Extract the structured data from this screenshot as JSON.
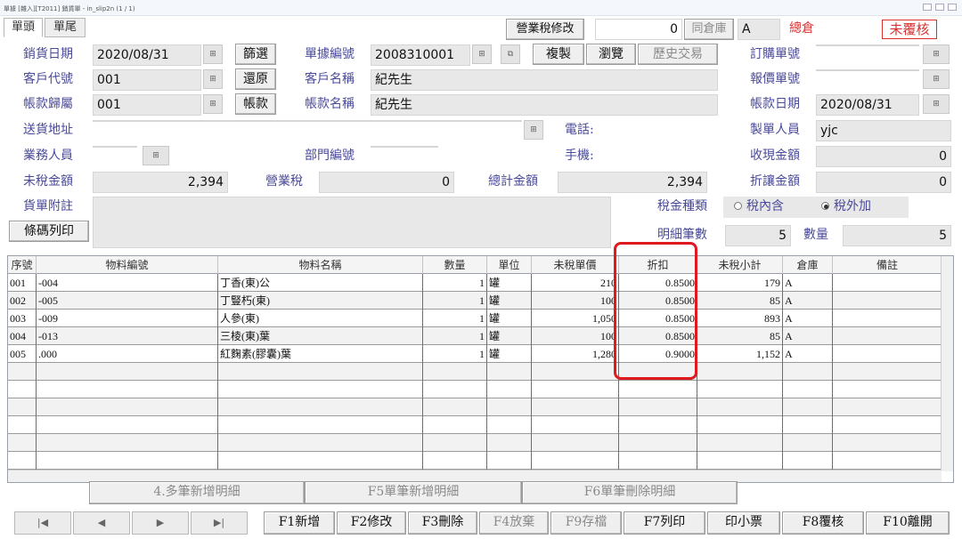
{
  "window": {
    "title": "單據 [雜入][T2011] 銷貨單 - in_slip2n  (1 / 1)"
  },
  "tabs": [
    "單頭",
    "單尾"
  ],
  "top": {
    "tax_modify_btn": "營業稅修改",
    "tax_value": "0",
    "same_warehouse_label": "同倉庫",
    "warehouse_code": "A",
    "warehouse_name": "總倉",
    "review_status": "未覆核"
  },
  "header": {
    "sale_date_label": "銷貨日期",
    "sale_date": "2020/08/31",
    "filter_btn": "篩選",
    "doc_no_label": "單據編號",
    "doc_no": "2008310001",
    "copy_btn": "複製",
    "browse_btn": "瀏覽",
    "history_btn": "歷史交易",
    "order_no_label": "訂購單號",
    "order_no": "",
    "customer_code_label": "客戶代號",
    "customer_code": "001",
    "restore_btn": "還原",
    "customer_name_label": "客戶名稱",
    "customer_name": "紀先生",
    "quote_no_label": "報價單號",
    "quote_no": "",
    "account_owner_label": "帳款歸屬",
    "account_owner": "001",
    "account_btn": "帳款",
    "account_name_label": "帳款名稱",
    "account_name": "紀先生",
    "account_date_label": "帳款日期",
    "account_date": "2020/08/31",
    "ship_addr_label": "送貨地址",
    "ship_addr": "",
    "phone_label": "電話:",
    "phone": "",
    "maker_label": "製單人員",
    "maker": "yjc",
    "salesperson_label": "業務人員",
    "salesperson": "",
    "dept_label": "部門編號",
    "dept": "",
    "mobile_label": "手機:",
    "mobile": "",
    "cash_label": "收現金額",
    "cash": "0",
    "untaxed_label": "未稅金額",
    "untaxed": "2,394",
    "tax_label": "營業稅",
    "tax": "0",
    "total_label": "總計金額",
    "total": "2,394",
    "discount_amt_label": "折讓金額",
    "discount_amt": "0",
    "note_label": "貨單附註",
    "note": "",
    "tax_type_label": "稅金種類",
    "tax_incl": "稅內含",
    "tax_excl": "稅外加",
    "tax_type_selected": "稅外加",
    "barcode_btn": "條碼列印",
    "detail_count_label": "明細筆數",
    "detail_count": "5",
    "qty_label": "數量",
    "qty_total": "5"
  },
  "grid": {
    "columns": [
      "序號",
      "物料編號",
      "物料名稱",
      "數量",
      "單位",
      "未稅單價",
      "折扣",
      "未稅小計",
      "倉庫",
      "備註"
    ],
    "rows": [
      {
        "seq": "001",
        "code": "-004",
        "name": "丁香(東)公",
        "qty": "1",
        "unit": "罐",
        "price": "210",
        "discount": "0.8500",
        "subtotal": "179",
        "wh": "A",
        "remark": ""
      },
      {
        "seq": "002",
        "code": "-005",
        "name": "丁豎朽(東)",
        "qty": "1",
        "unit": "罐",
        "price": "100",
        "discount": "0.8500",
        "subtotal": "85",
        "wh": "A",
        "remark": ""
      },
      {
        "seq": "003",
        "code": "-009",
        "name": "人參(東)",
        "qty": "1",
        "unit": "罐",
        "price": "1,050",
        "discount": "0.8500",
        "subtotal": "893",
        "wh": "A",
        "remark": ""
      },
      {
        "seq": "004",
        "code": "-013",
        "name": "三棱(東)葉",
        "qty": "1",
        "unit": "罐",
        "price": "100",
        "discount": "0.8500",
        "subtotal": "85",
        "wh": "A",
        "remark": ""
      },
      {
        "seq": "005",
        "code": ".000",
        "name": "紅麴素(膠囊)葉",
        "qty": "1",
        "unit": "罐",
        "price": "1,280",
        "discount": "0.9000",
        "subtotal": "1,152",
        "wh": "A",
        "remark": ""
      }
    ]
  },
  "detail_buttons": [
    "4.多筆新增明細",
    "F5單筆新增明細",
    "F6單筆刪除明細"
  ],
  "nav_buttons": [
    "|◀",
    "◀",
    "▶",
    "▶|"
  ],
  "function_buttons": [
    "F1新增",
    "F2修改",
    "F3刪除",
    "F4放棄",
    "F9存檔",
    "F7列印",
    "印小票",
    "F8覆核",
    "F10離開"
  ]
}
